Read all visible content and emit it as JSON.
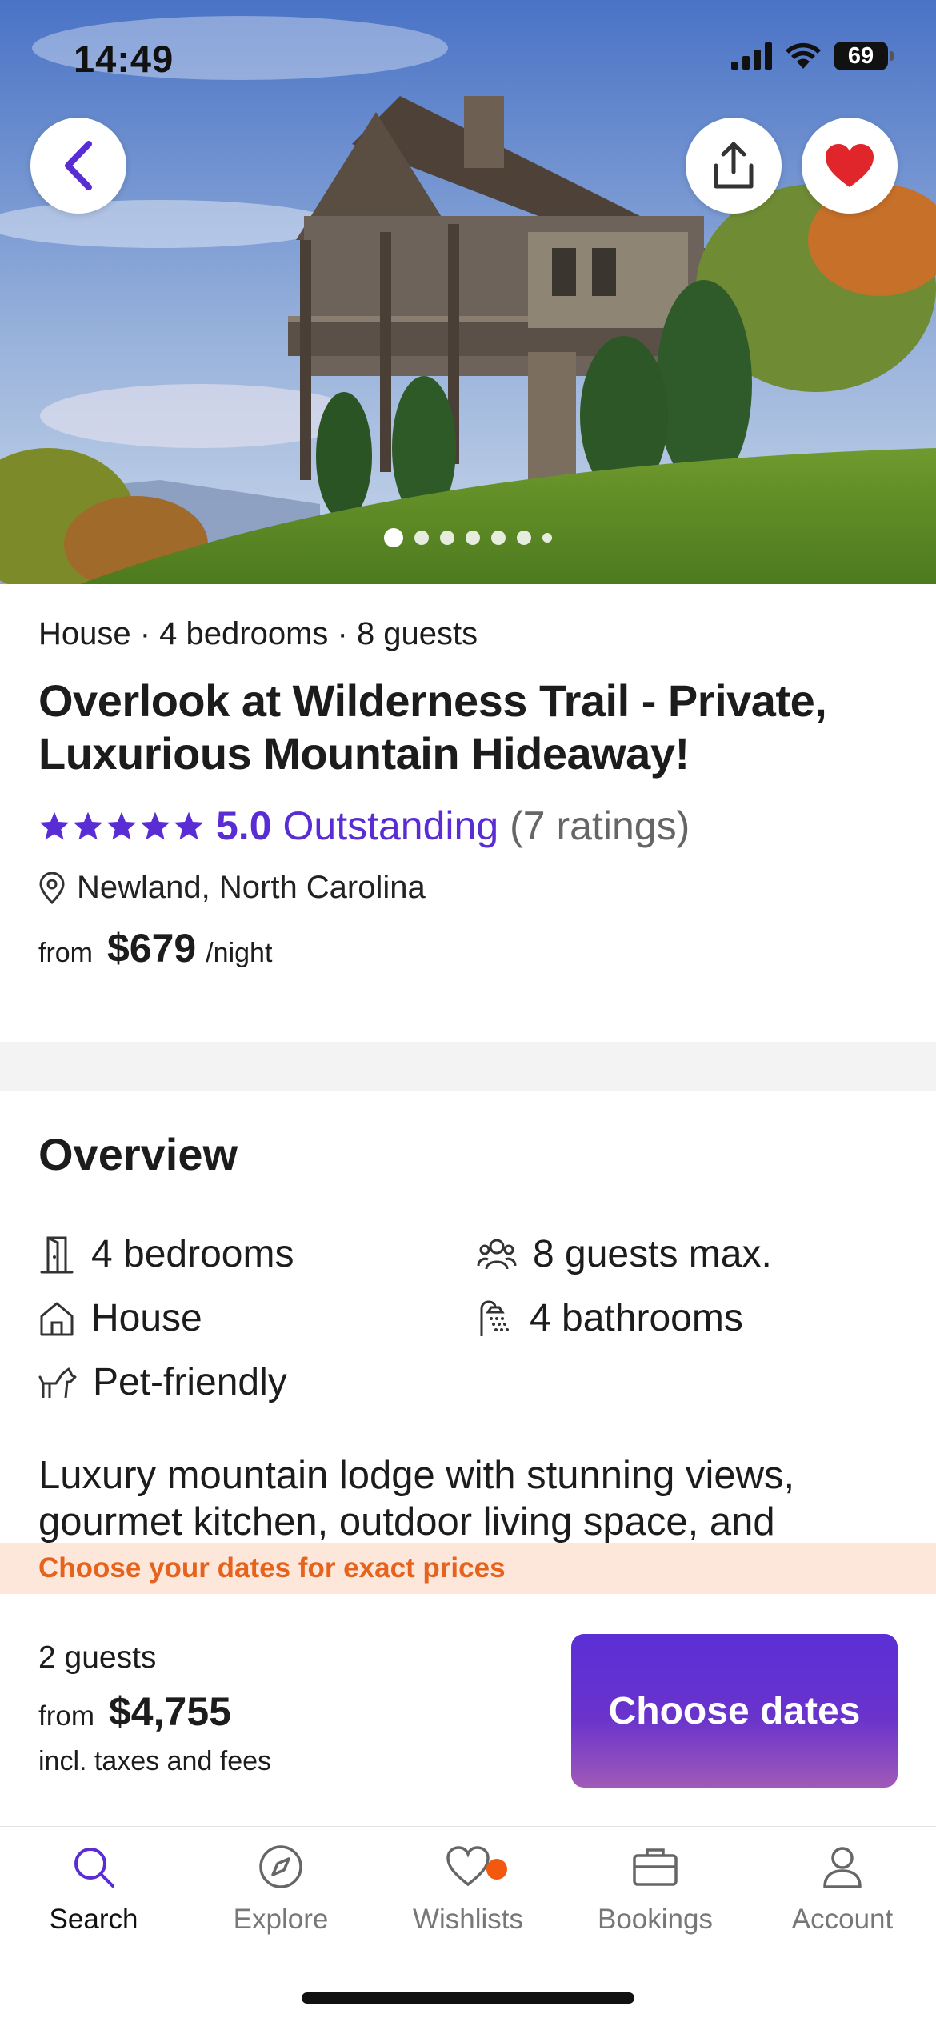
{
  "status_bar": {
    "time": "14:49",
    "battery": "69"
  },
  "hero": {
    "photo_count": 7,
    "active_index": 0
  },
  "listing": {
    "meta": "House · 4 bedrooms · 8 guests",
    "title": "Overlook at Wilderness Trail - Private, Luxurious Mountain Hideaway!",
    "rating_score": "5.0",
    "rating_label": "Outstanding",
    "rating_count": "(7 ratings)",
    "stars": 5,
    "location": "Newland, North Carolina",
    "price_from": "from",
    "price": "$679",
    "price_unit": "/night"
  },
  "overview": {
    "heading": "Overview",
    "facts": {
      "bedrooms": "4 bedrooms",
      "guests": "8 guests max.",
      "type": "House",
      "bathrooms": "4 bathrooms",
      "pets": "Pet-friendly"
    },
    "description": "Luxury mountain lodge with stunning views, gourmet kitchen, outdoor living space, and"
  },
  "banner": {
    "text": "Choose your dates for exact prices"
  },
  "booking": {
    "guests": "2 guests",
    "from": "from",
    "total": "$4,755",
    "incl": "incl. taxes and fees",
    "cta": "Choose dates"
  },
  "tabs": [
    {
      "label": "Search",
      "icon": "search-icon",
      "active": true
    },
    {
      "label": "Explore",
      "icon": "compass-icon",
      "active": false
    },
    {
      "label": "Wishlists",
      "icon": "heart-icon",
      "active": false,
      "badge": true
    },
    {
      "label": "Bookings",
      "icon": "briefcase-icon",
      "active": false
    },
    {
      "label": "Account",
      "icon": "person-icon",
      "active": false
    }
  ],
  "colors": {
    "brand": "#5a2dd4",
    "heart": "#e0262a",
    "banner_text": "#e5631d",
    "banner_bg": "#fde6da",
    "badge": "#f2590f"
  }
}
